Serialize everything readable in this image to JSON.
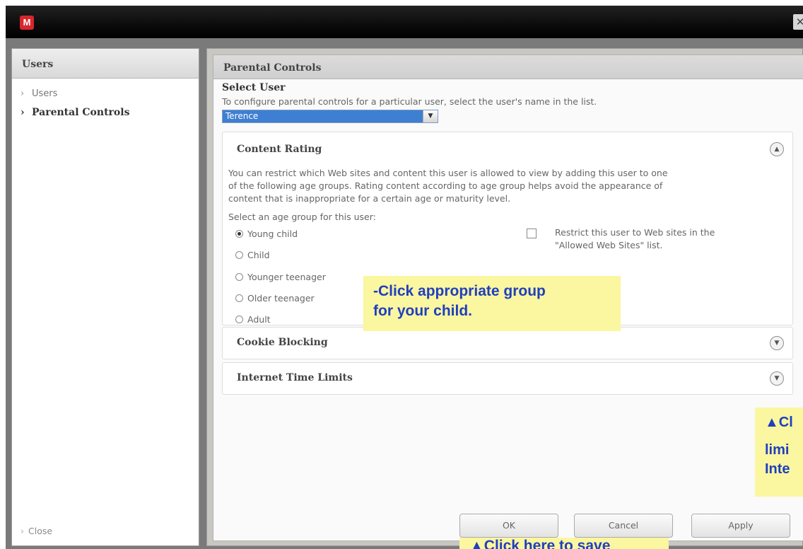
{
  "window": {
    "logo_letter": "M",
    "close_glyph": "✕"
  },
  "sidebar": {
    "header": "Users",
    "items": [
      {
        "label": "Users",
        "active": false
      },
      {
        "label": "Parental Controls",
        "active": true
      }
    ],
    "close_label": "Close"
  },
  "main": {
    "header": "Parental Controls",
    "select_user": {
      "title": "Select User",
      "description": "To configure parental controls for a particular user, select the user's name in the list.",
      "selected_value": "Terence"
    },
    "content_rating": {
      "title": "Content Rating",
      "description_lines": [
        "You can restrict which Web sites and content this user is allowed to view by adding this user to one",
        "of the following age groups. Rating content according to age group helps avoid the appearance of",
        "content that is inappropriate for a certain age or maturity level."
      ],
      "age_group_prompt": "Select an age group for this user:",
      "age_groups": [
        "Young child",
        "Child",
        "Younger teenager",
        "Older teenager",
        "Adult"
      ],
      "selected_age_group": "Young child",
      "restrict_label_lines": [
        "Restrict this user to Web sites in the",
        "\"Allowed Web Sites\" list."
      ],
      "restrict_checked": false
    },
    "cookie_blocking": {
      "title": "Cookie Blocking"
    },
    "internet_time_limits": {
      "title": "Internet Time Limits"
    },
    "buttons": {
      "ok": "OK",
      "cancel": "Cancel",
      "apply": "Apply"
    }
  },
  "callouts": {
    "age_group": [
      "-Click appropriate group",
      "for your child."
    ],
    "time_limits": [
      "▲Cl",
      "limi",
      "Inte"
    ],
    "save": "▲Click here to save"
  },
  "icons": {
    "collapse": "up-arrows-circle-icon",
    "expand": "down-arrows-circle-icon",
    "dropdown": "dropdown-arrow-icon",
    "sidebar_chevron": "chevron-right-icon"
  }
}
